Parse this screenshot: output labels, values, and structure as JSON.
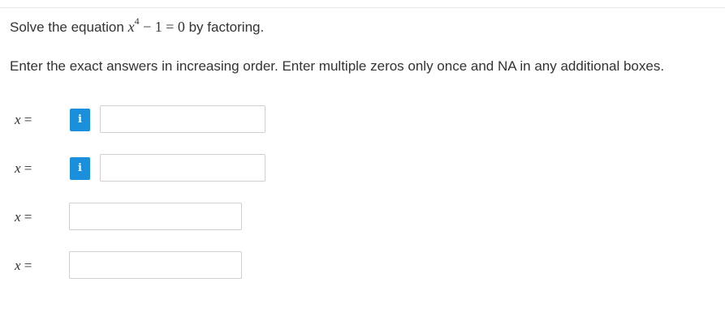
{
  "question": {
    "prefix": "Solve the equation ",
    "math_var": "x",
    "math_exponent": "4",
    "math_rest": " − 1 = 0",
    "suffix": " by factoring."
  },
  "instructions": "Enter the exact answers in increasing order. Enter multiple zeros only once and NA in any additional boxes.",
  "answers": [
    {
      "label_var": "x",
      "label_eq": " =",
      "info_icon": "i",
      "value": ""
    },
    {
      "label_var": "x",
      "label_eq": " =",
      "info_icon": "i",
      "value": ""
    },
    {
      "label_var": "x",
      "label_eq": " =",
      "value": ""
    },
    {
      "label_var": "x",
      "label_eq": " =",
      "value": ""
    }
  ],
  "colors": {
    "info_button": "#1a8fdc",
    "text": "#333333",
    "input_border": "#cfcfcf"
  }
}
